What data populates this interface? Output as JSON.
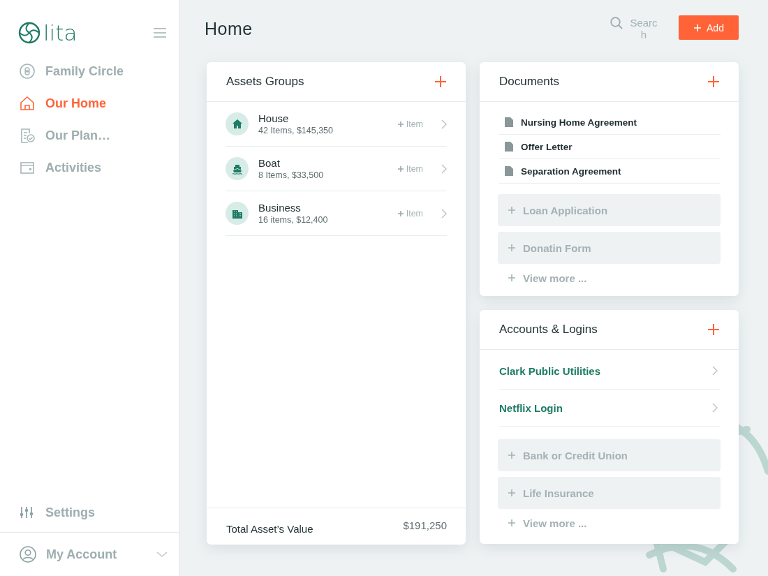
{
  "sidebar": {
    "logo": "lita",
    "nav": [
      {
        "label": "Family Circle",
        "selected": false
      },
      {
        "label": "Our Home",
        "selected": true
      },
      {
        "label": "Our Plan…",
        "selected": false
      },
      {
        "label": "Activities",
        "selected": false
      }
    ],
    "settings": "Settings",
    "account": "My Account"
  },
  "header": {
    "title": "Home",
    "search": {
      "placeholder": "Search"
    },
    "add_button": "Add"
  },
  "assets": {
    "title": "Assets Groups",
    "groups": [
      {
        "name": "House",
        "summary": "42 Items, $145,350",
        "action": "Item"
      },
      {
        "name": "Boat",
        "summary": "8 Items, $33,500",
        "action": "Item"
      },
      {
        "name": "Business",
        "summary": "16 items, $12,400",
        "action": "Item"
      }
    ],
    "total_label": "Total Asset’s Value",
    "total_value": "$191,250"
  },
  "documents": {
    "title": "Documents",
    "files": [
      "Nursing Home Agreement",
      "Offer Letter",
      "Separation Agreement"
    ],
    "suggestions": [
      "Loan Application",
      "Donatin Form"
    ],
    "view_more": "View more ..."
  },
  "accounts": {
    "title": "Accounts & Logins",
    "items": [
      "Clark Public Utilities",
      "Netflix Login"
    ],
    "suggestions": [
      "Bank or Credit Union",
      "Life Insurance"
    ],
    "view_more": "View more ..."
  }
}
